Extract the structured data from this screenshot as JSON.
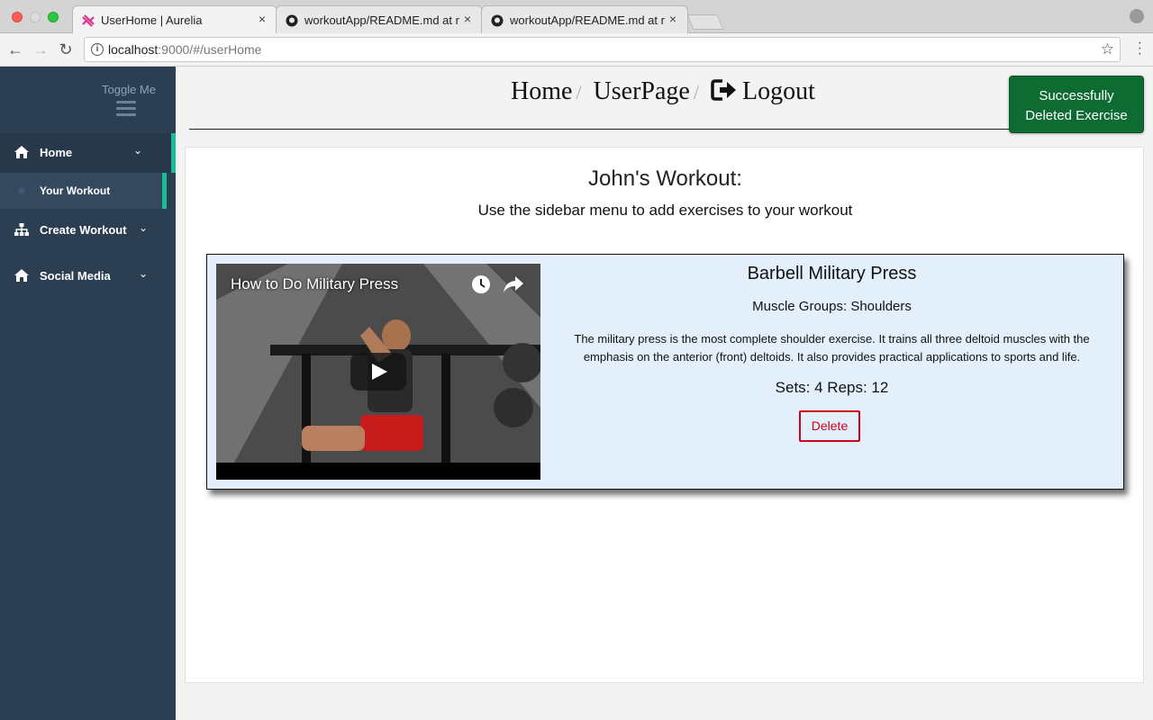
{
  "browser": {
    "tabs": [
      {
        "title": "UserHome | Aurelia",
        "close": "×",
        "active": true
      },
      {
        "title": "workoutApp/README.md at m",
        "close": "×",
        "active": false
      },
      {
        "title": "workoutApp/README.md at m",
        "close": "×",
        "active": false
      }
    ],
    "url_host": "localhost",
    "url_rest": ":9000/#/userHome"
  },
  "sidebar": {
    "toggle_label": "Toggle Me",
    "items": [
      {
        "label": "Home",
        "icon": "home-icon"
      },
      {
        "label": "Create Workout",
        "icon": "sitemap-icon"
      },
      {
        "label": "Social Media",
        "icon": "home-icon"
      }
    ],
    "sub_item": "Your Workout",
    "chevron": "⌄",
    "accent_color": "#1abc9c",
    "bg_color": "#2b3e52"
  },
  "header": {
    "crumbs": [
      "Home",
      "UserPage",
      "Logout"
    ],
    "separator": "/"
  },
  "toast": {
    "line1": "Successfully",
    "line2": "Deleted Exercise",
    "color": "#0e6b32"
  },
  "main": {
    "title": "John's Workout:",
    "subtitle": "Use the sidebar menu to add exercises to your workout"
  },
  "exercise": {
    "video_title": "How to Do Military Press",
    "name": "Barbell Military Press",
    "muscle_groups": "Muscle Groups: Shoulders",
    "description": "The military press is the most complete shoulder exercise. It trains all three deltoid muscles with the emphasis on the anterior (front) deltoids. It also provides practical applications to sports and life.",
    "sets_reps": "Sets: 4 Reps: 12",
    "delete_label": "Delete",
    "delete_color": "#d0021b"
  }
}
